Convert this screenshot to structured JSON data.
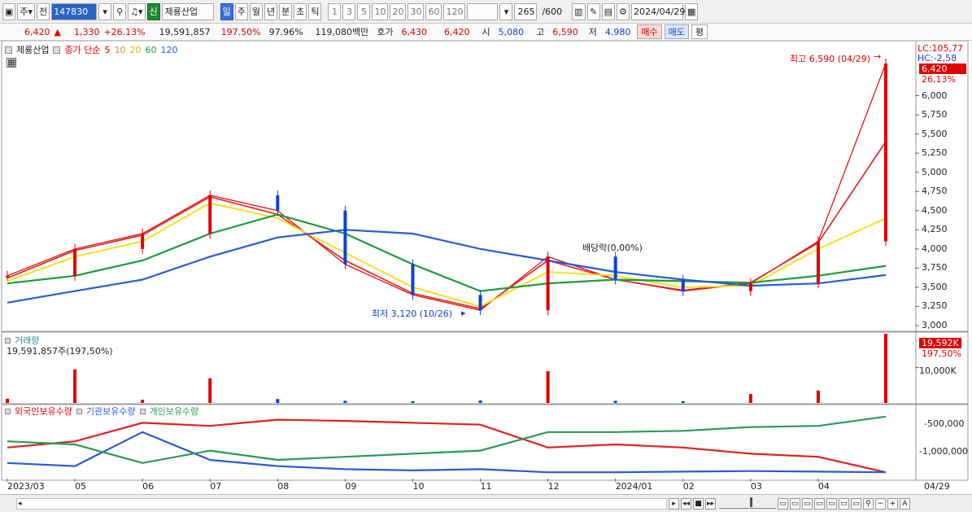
{
  "toolbar": {
    "stock_code": "147830",
    "stock_name": "제룡산업",
    "tag_new": "신",
    "label_main": "주",
    "label_prev": "전",
    "periods": [
      "일",
      "주",
      "월",
      "년",
      "분",
      "초",
      "틱"
    ],
    "active_period": "일",
    "minute_options": [
      "1",
      "3",
      "5",
      "10",
      "20",
      "30",
      "60",
      "120"
    ],
    "count_value": "265",
    "count_total": "/600",
    "date": "2024/04/29"
  },
  "quote": {
    "price": "6,420",
    "change": "1,330",
    "change_pct": "+26.13%",
    "volume": "19,591,857",
    "volume_ratio": "197.50%",
    "turnover_pct": "97.96%",
    "amount": "119,080백만",
    "ask_label": "호가",
    "ask": "6,430",
    "bid": "6,420",
    "open_label": "시",
    "open": "5,080",
    "high_label": "고",
    "high": "6,590",
    "low_label": "저",
    "low": "4,980",
    "buy_label": "매수",
    "sell_label": "매도",
    "avg_label": "평"
  },
  "price_pane": {
    "stock_label": "제룡산업",
    "ma_label": "종가 단순",
    "ma_periods": [
      "5",
      "10",
      "20",
      "60",
      "120"
    ],
    "lc_label": "LC:105,77",
    "hc_label": "HC:-2,58",
    "last_price_tag": "6,420",
    "last_pct_tag": "26,13%",
    "y_ticks": [
      "6,000",
      "5,750",
      "5,500",
      "5,250",
      "5,000",
      "4,750",
      "4,500",
      "4,250",
      "4,000",
      "3,750",
      "3,500",
      "3,250",
      "3,000"
    ],
    "high_annotation": "최고 6,590 (04/29)",
    "low_annotation": "최저 3,120 (10/26)",
    "dividend_annotation": "배당락(0,00%)"
  },
  "volume_pane": {
    "title": "거래량",
    "value_text": "19,591,857주(197,50%)",
    "tag_value": "19,592K",
    "tag_pct": "197,50%",
    "y_ticks": [
      "10,000K"
    ]
  },
  "holdings_pane": {
    "legend": [
      "외국인보유수량",
      "기관보유수량",
      "개인보유수량"
    ],
    "y_ticks": [
      "-500,000",
      "-1,000,000"
    ]
  },
  "x_axis": {
    "labels": [
      "2023/03",
      "05",
      "06",
      "07",
      "08",
      "09",
      "10",
      "11",
      "12",
      "2024/01",
      "02",
      "03",
      "04"
    ],
    "last_label": "04/29"
  },
  "colors": {
    "up": "#e00000",
    "down": "#1040d0",
    "ma5": "#e02020",
    "ma10": "#f08a1a",
    "ma20": "#f5e020",
    "ma60": "#1a9a3a",
    "ma120": "#2a5ad8",
    "foreign": "#e02020",
    "institution": "#2a5ad8",
    "individual": "#2a9a55"
  },
  "chart_data": {
    "type": "line",
    "x": [
      "2023/03",
      "05",
      "06",
      "07",
      "08",
      "09",
      "10",
      "11",
      "12",
      "2024/01",
      "02",
      "03",
      "04",
      "04/29"
    ],
    "series": [
      {
        "name": "종가",
        "values": [
          3650,
          4000,
          4200,
          4700,
          4500,
          3800,
          3400,
          3200,
          3900,
          3600,
          3450,
          3550,
          4100,
          6420
        ]
      },
      {
        "name": "5",
        "values": [
          3620,
          3980,
          4180,
          4680,
          4450,
          3850,
          3420,
          3220,
          3850,
          3600,
          3460,
          3560,
          4080,
          5400
        ]
      },
      {
        "name": "20",
        "values": [
          3580,
          3900,
          4100,
          4600,
          4400,
          3950,
          3500,
          3250,
          3700,
          3650,
          3500,
          3520,
          4000,
          4400
        ]
      },
      {
        "name": "60",
        "values": [
          3550,
          3650,
          3850,
          4200,
          4450,
          4200,
          3800,
          3450,
          3550,
          3600,
          3580,
          3560,
          3650,
          3780
        ]
      },
      {
        "name": "120",
        "values": [
          3300,
          3450,
          3600,
          3900,
          4150,
          4250,
          4200,
          4000,
          3850,
          3700,
          3600,
          3520,
          3550,
          3660
        ]
      }
    ],
    "volume_k": [
      1200,
      9500,
      900,
      7000,
      1100,
      600,
      500,
      700,
      9000,
      600,
      500,
      2500,
      3500,
      19592
    ],
    "ylim": [
      3000,
      6590
    ]
  }
}
